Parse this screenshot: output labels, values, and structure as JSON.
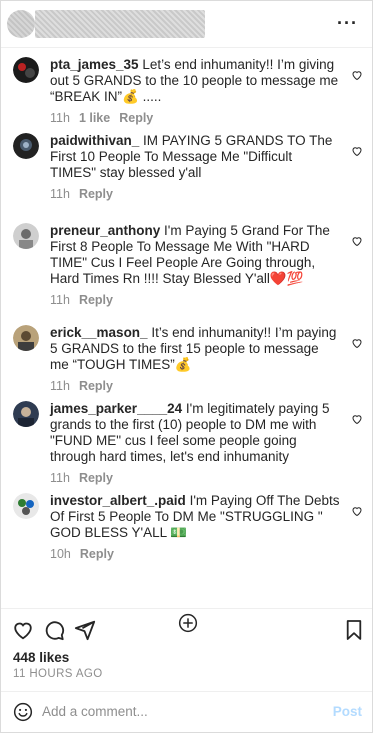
{
  "header": {
    "more_icon": "more-horizontal-icon"
  },
  "comments": [
    {
      "username": "pta_james_35",
      "text": " Let’s end inhumanity!! I’m giving out 5 GRANDS to the 10 people to message me “BREAK IN”💰 .....",
      "time": "11h",
      "likes": "1 like",
      "reply": "Reply"
    },
    {
      "username": "paidwithivan_",
      "text": " IM PAYING 5 GRANDS TO The First 10 People To Message Me \"Difficult TIMES\" stay blessed y'all",
      "time": "11h",
      "likes": "",
      "reply": "Reply"
    },
    {
      "username": "preneur_anthony",
      "text": " I'm Paying 5 Grand For The First 8 People To Message Me With \"HARD TIME\" Cus I Feel People Are Going through, Hard Times Rn !!!! Stay Blessed Y'all❤️💯",
      "time": "11h",
      "likes": "",
      "reply": "Reply"
    },
    {
      "username": "erick__mason_",
      "text": " It’s end inhumanity!! I’m paying 5 GRANDS to the first 15 people to message me “TOUGH TIMES”💰",
      "time": "11h",
      "likes": "",
      "reply": "Reply"
    },
    {
      "username": "james_parker____24",
      "text": " I'm legitimately paying 5 grands to the first (10) people to DM me with \"FUND ME\" cus I feel some people going through hard times, let's end inhumanity",
      "time": "11h",
      "likes": "",
      "reply": "Reply"
    },
    {
      "username": "investor_albert_.paid",
      "text": " I'm Paying Off The Debts Of First 5 People To DM Me \"STRUGGLING \" GOD BLESS Y'ALL 💵",
      "time": "10h",
      "likes": "",
      "reply": "Reply"
    }
  ],
  "post": {
    "likes": "448 likes",
    "time_ago": "11 HOURS AGO",
    "comment_placeholder": "Add a comment...",
    "post_label": "Post"
  },
  "colors": {
    "text": "#262626",
    "muted": "#8e8e8e",
    "post_disabled": "#b3dbff",
    "divider": "#efefef"
  }
}
